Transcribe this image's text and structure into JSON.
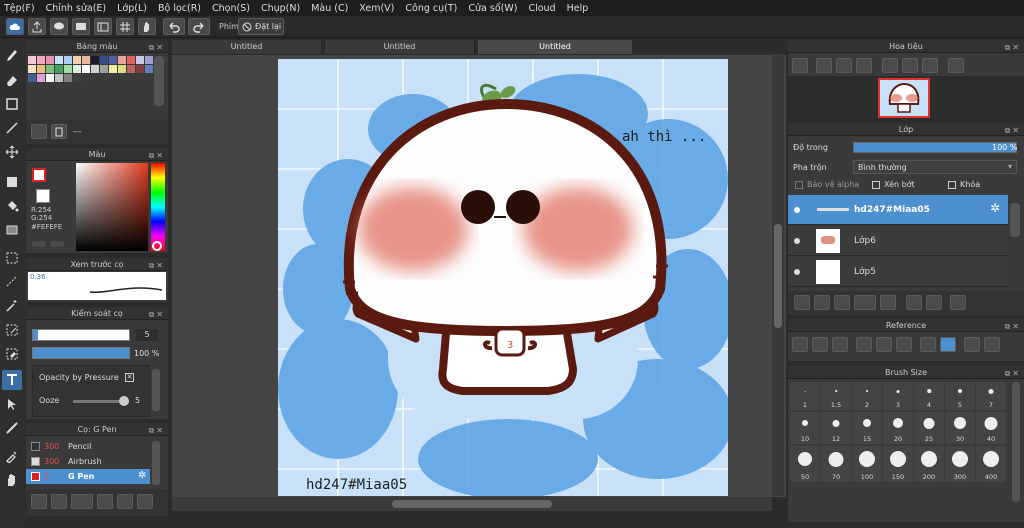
{
  "menu": [
    "Tệp(F)",
    "Chỉnh sửa(E)",
    "Lớp(L)",
    "Bộ lọc(R)",
    "Chọn(S)",
    "Chụp(N)",
    "Màu (C)",
    "Xem(V)",
    "Công cụ(T)",
    "Cửa sổ(W)",
    "Cloud",
    "Help"
  ],
  "toolbar": {
    "key_label": "Phím",
    "reset_label": "Đặt lại"
  },
  "tabs": [
    "Untitled",
    "Untitled",
    "Untitled"
  ],
  "palette": {
    "title": "Bảng màu",
    "footer": "---"
  },
  "color": {
    "title": "Màu",
    "r": "R:254",
    "g": "G:254",
    "hex": "#FEFEFE"
  },
  "brush_preview": {
    "title": "Xem trước cọ",
    "size": "0.36"
  },
  "brush_control": {
    "title": "Kiểm soát cọ",
    "size_value": "5",
    "opacity_value": "100 %",
    "opacity_by_pressure": "Opacity by Pressure",
    "ooze_label": "Ooze",
    "ooze_value": "5"
  },
  "brush_list": {
    "title": "Cọ: G Pen",
    "items": [
      {
        "size": "300",
        "name": "Pencil"
      },
      {
        "size": "300",
        "name": "Airbrush"
      },
      {
        "size": "5",
        "name": "G Pen"
      }
    ]
  },
  "canvas": {
    "text1": "ah thì ...",
    "text2": "hd247#Miaa05"
  },
  "navigator": {
    "title": "Hoa tiêu"
  },
  "layers": {
    "title": "Lớp",
    "opacity_label": "Độ trong",
    "opacity_value": "100 %",
    "blend_label": "Pha trộn",
    "blend_value": "Bình thường",
    "protect_alpha": "Bảo vệ alpha",
    "clipping": "Xén bớt",
    "lock": "Khóa",
    "items": [
      {
        "name": "hd247#Miaa05"
      },
      {
        "name": "Lớp6"
      },
      {
        "name": "Lớp5"
      }
    ]
  },
  "reference": {
    "title": "Reference"
  },
  "brush_size": {
    "title": "Brush Size",
    "sizes": [
      "1",
      "1.5",
      "2",
      "3",
      "4",
      "5",
      "7",
      "10",
      "12",
      "15",
      "20",
      "25",
      "30",
      "40",
      "50",
      "70",
      "100",
      "150",
      "200",
      "300",
      "400"
    ]
  },
  "colors": {
    "accent": "#4c90d0",
    "bg": "#2b2b2b",
    "panel": "#3a3a3a",
    "mushroom_outline": "#5a1a10",
    "blush": "#e07060",
    "sky": "#c8e0f8"
  }
}
